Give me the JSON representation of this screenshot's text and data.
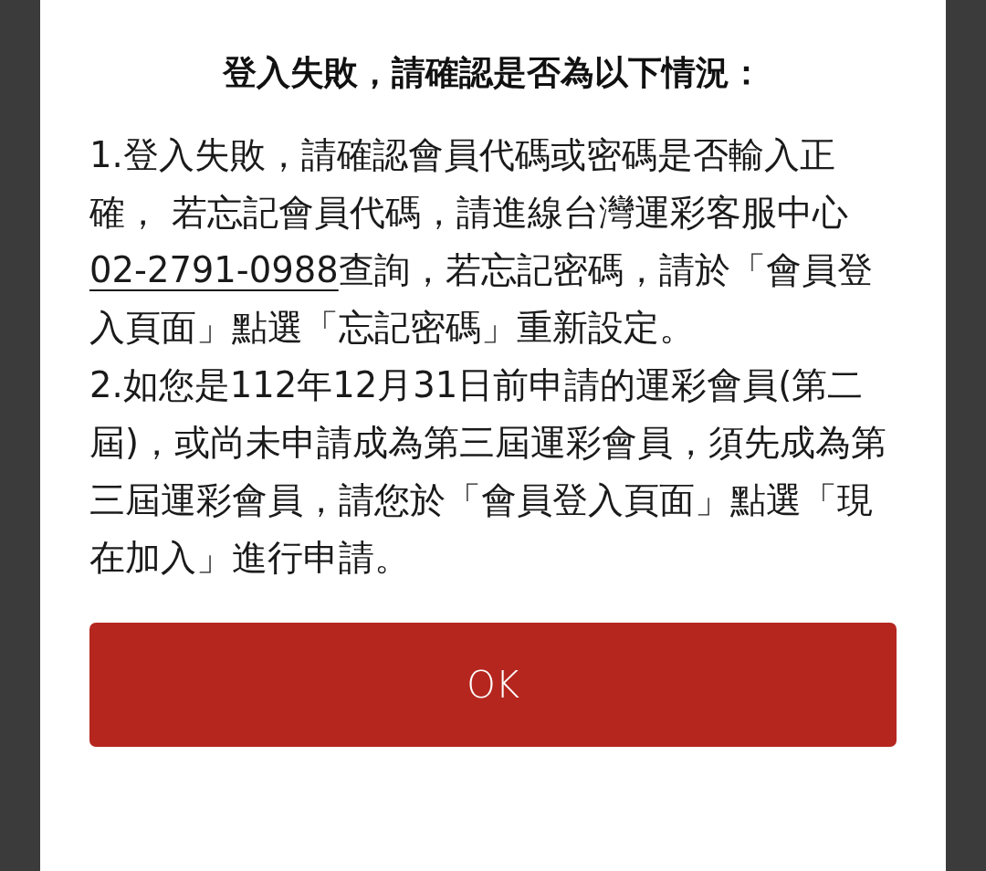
{
  "dialog": {
    "title": "登入失敗，請確認是否為以下情況：",
    "items": [
      {
        "before": "1.登入失敗，請確認會員代碼或密碼是否輸入正確， 若忘記會員代碼，請進線台灣運彩客服中心",
        "link": "02-2791-0988",
        "after": "查詢，若忘記密碼，請於「會員登入頁面」點選「忘記密碼」重新設定。"
      },
      {
        "before": "2.如您是112年12月31日前申請的運彩會員(第二屆)，或尚未申請成為第三屆運彩會員，須先成為第三屆運彩會員，請您於「會員登入頁面」點選「現在加入」進行申請。"
      }
    ],
    "button": "OK"
  }
}
